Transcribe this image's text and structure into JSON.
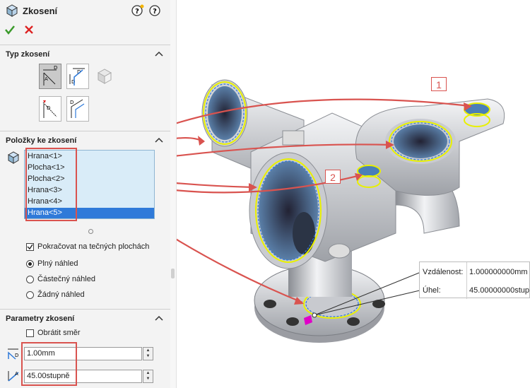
{
  "panel": {
    "title": "Zkosení",
    "help_icons": [
      "help-bulb-icon",
      "help-icon"
    ],
    "ok_icon": "checkmark-icon",
    "cancel_icon": "cross-icon"
  },
  "chamfer_type": {
    "section_title": "Typ zkosení",
    "buttons": [
      "angle-distance",
      "distance-distance",
      "vertex",
      "offset-face",
      "face-face"
    ]
  },
  "items": {
    "section_title": "Položky ke zkosení",
    "list": [
      "Hrana<1>",
      "Plocha<1>",
      "Plocha<2>",
      "Hrana<3>",
      "Hrana<4>",
      "Hrana<5>"
    ],
    "selected_index": 5,
    "tangent_propagation": {
      "label": "Pokračovat na tečných plochách",
      "checked": true
    },
    "preview_options": [
      {
        "label": "Plný náhled",
        "selected": true
      },
      {
        "label": "Částečný náhled",
        "selected": false
      },
      {
        "label": "Žádný náhled",
        "selected": false
      }
    ]
  },
  "parameters": {
    "section_title": "Parametry zkosení",
    "flip": {
      "label": "Obrátit směr",
      "checked": false
    },
    "distance_value": "1.00mm",
    "angle_value": "45.00stupně"
  },
  "viewport": {
    "callouts": [
      "1",
      "2"
    ],
    "dimension_box": {
      "distance_label": "Vzdálenost:",
      "distance_value": "1.000000000mm",
      "angle_label": "Úhel:",
      "angle_value": "45.00000000stup"
    }
  },
  "colors": {
    "accent_red": "#d9534f",
    "selection_blue": "#2f7ad9",
    "highlight_yellow": "#e8f000",
    "ok_green": "#3a9a2a"
  }
}
